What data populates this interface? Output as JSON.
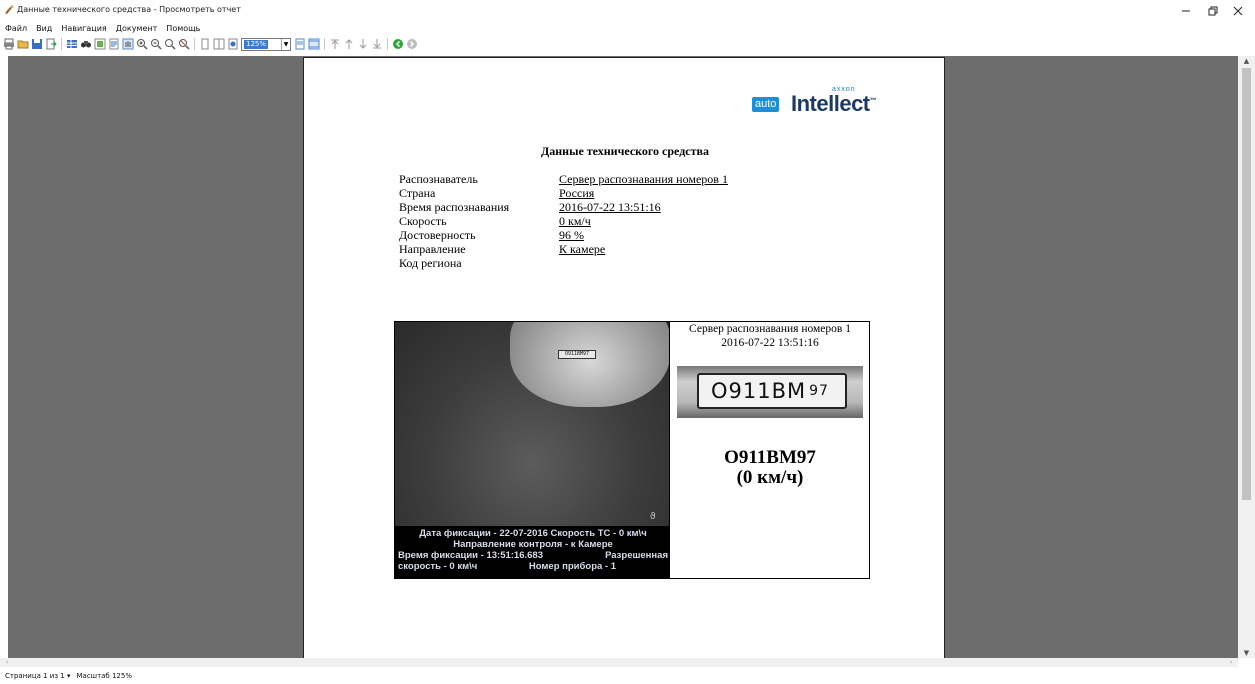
{
  "window": {
    "title": "Данные технического средства - Просмотреть отчет"
  },
  "menu": [
    "Файл",
    "Вид",
    "Навигация",
    "Документ",
    "Помощь"
  ],
  "toolbar": {
    "zoom_value": "125%"
  },
  "logo": {
    "brand": "axxon",
    "auto": "auto",
    "name": "Intellect"
  },
  "report": {
    "heading": "Данные технического средства",
    "fields": [
      {
        "label": "Распознаватель",
        "value": "Сервер распознавания номеров 1"
      },
      {
        "label": "Страна",
        "value": "Россия"
      },
      {
        "label": "Время распознавания",
        "value": "2016-07-22 13:51:16"
      },
      {
        "label": "Скорость",
        "value": "0 км/ч"
      },
      {
        "label": "Достоверность",
        "value": "96 %"
      },
      {
        "label": "Направление",
        "value": "К камере"
      },
      {
        "label": "Код региона",
        "value": ""
      }
    ],
    "capture": {
      "caption": {
        "line1": "Дата фиксации - 22-07-2016 Скорость ТС - 0 км\\ч",
        "line2": "Направление контроля - к Камере",
        "line3_left": "Время фиксации - 13:51:16.683",
        "line3_right": "Разрешенная",
        "line4_left": "скорость - 0 км\\ч",
        "line4_right": "Номер прибора - 1"
      },
      "car_plate_small": "O911BM97",
      "server": "Сервер распознавания номеров 1",
      "timestamp": "2016-07-22 13:51:16",
      "plate_main": "O911BM",
      "plate_region": "97",
      "plate_number": "O911BM97",
      "speed": "(0 км/ч)"
    }
  },
  "status": {
    "page": "Страница 1 из 1",
    "zoom": "Масштаб 125%"
  },
  "colors": {
    "workspace": "#6d6d6d",
    "brand_blue": "#1c8fd8",
    "brand_dark": "#1d3a64"
  }
}
